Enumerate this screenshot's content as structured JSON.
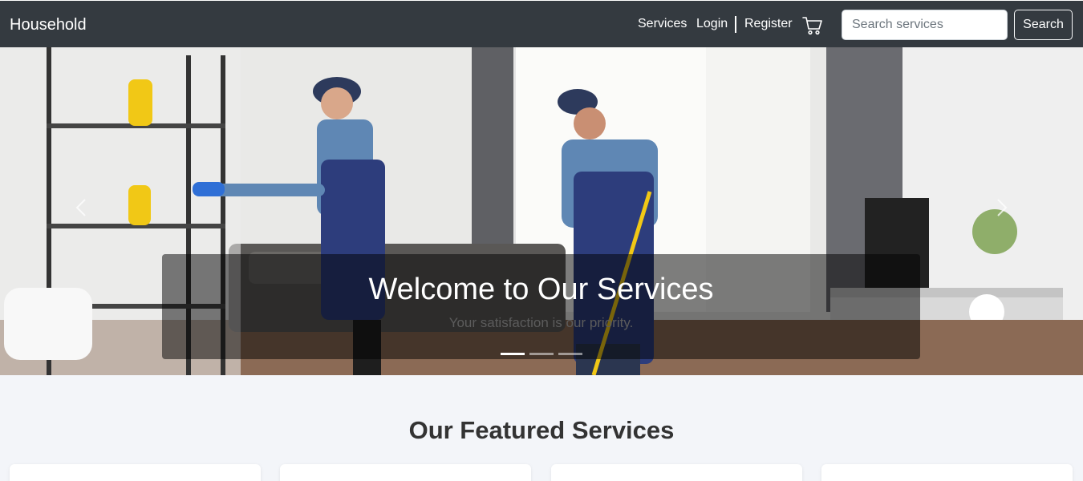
{
  "navbar": {
    "brand": "Household",
    "links": {
      "services": "Services",
      "login": "Login",
      "register": "Register"
    },
    "cart_icon": "shopping-cart-icon",
    "search": {
      "placeholder": "Search services",
      "value": "",
      "button_label": "Search"
    },
    "background_color": "#343a40"
  },
  "hero": {
    "title": "Welcome to Our Services",
    "subtitle": "Your satisfaction is our priority.",
    "prev_icon": "chevron-left-icon",
    "next_icon": "chevron-right-icon",
    "slides_count": 3,
    "active_slide": 1
  },
  "featured": {
    "title": "Our Featured Services",
    "cards": [
      {},
      {},
      {},
      {}
    ]
  }
}
